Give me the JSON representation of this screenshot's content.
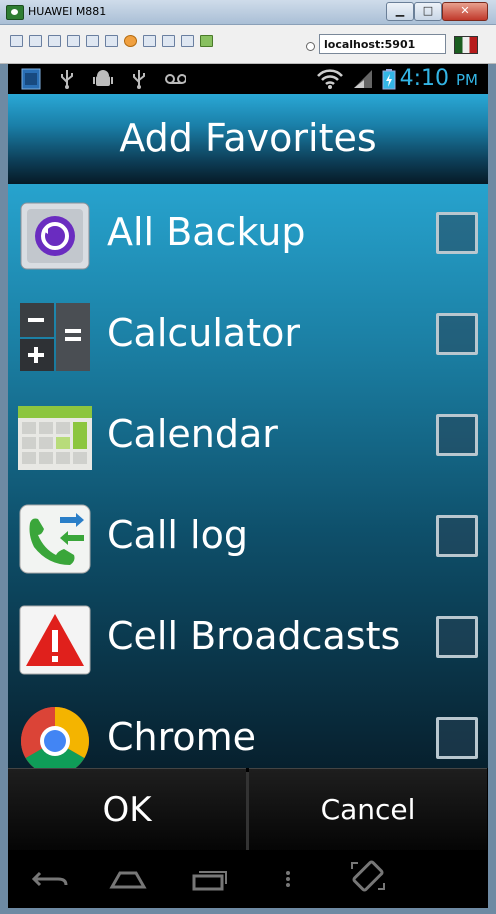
{
  "window": {
    "title": "HUAWEI M881",
    "minimize": "▁",
    "maximize": "□",
    "close": "✕"
  },
  "toolbar": {
    "address": "localhost:5901"
  },
  "statusbar": {
    "time": "4:10",
    "ampm": "PM"
  },
  "header": {
    "title": "Add Favorites"
  },
  "apps": [
    {
      "label": "All Backup",
      "icon": "all-backup-icon"
    },
    {
      "label": "Calculator",
      "icon": "calculator-icon"
    },
    {
      "label": "Calendar",
      "icon": "calendar-icon"
    },
    {
      "label": "Call log",
      "icon": "call-log-icon"
    },
    {
      "label": "Cell Broadcasts",
      "icon": "cell-broadcasts-icon"
    },
    {
      "label": "Chrome",
      "icon": "chrome-icon"
    }
  ],
  "buttons": {
    "ok": "OK",
    "cancel": "Cancel"
  },
  "colors": {
    "accent": "#33b5e5",
    "header_top": "#2aa8d6"
  }
}
